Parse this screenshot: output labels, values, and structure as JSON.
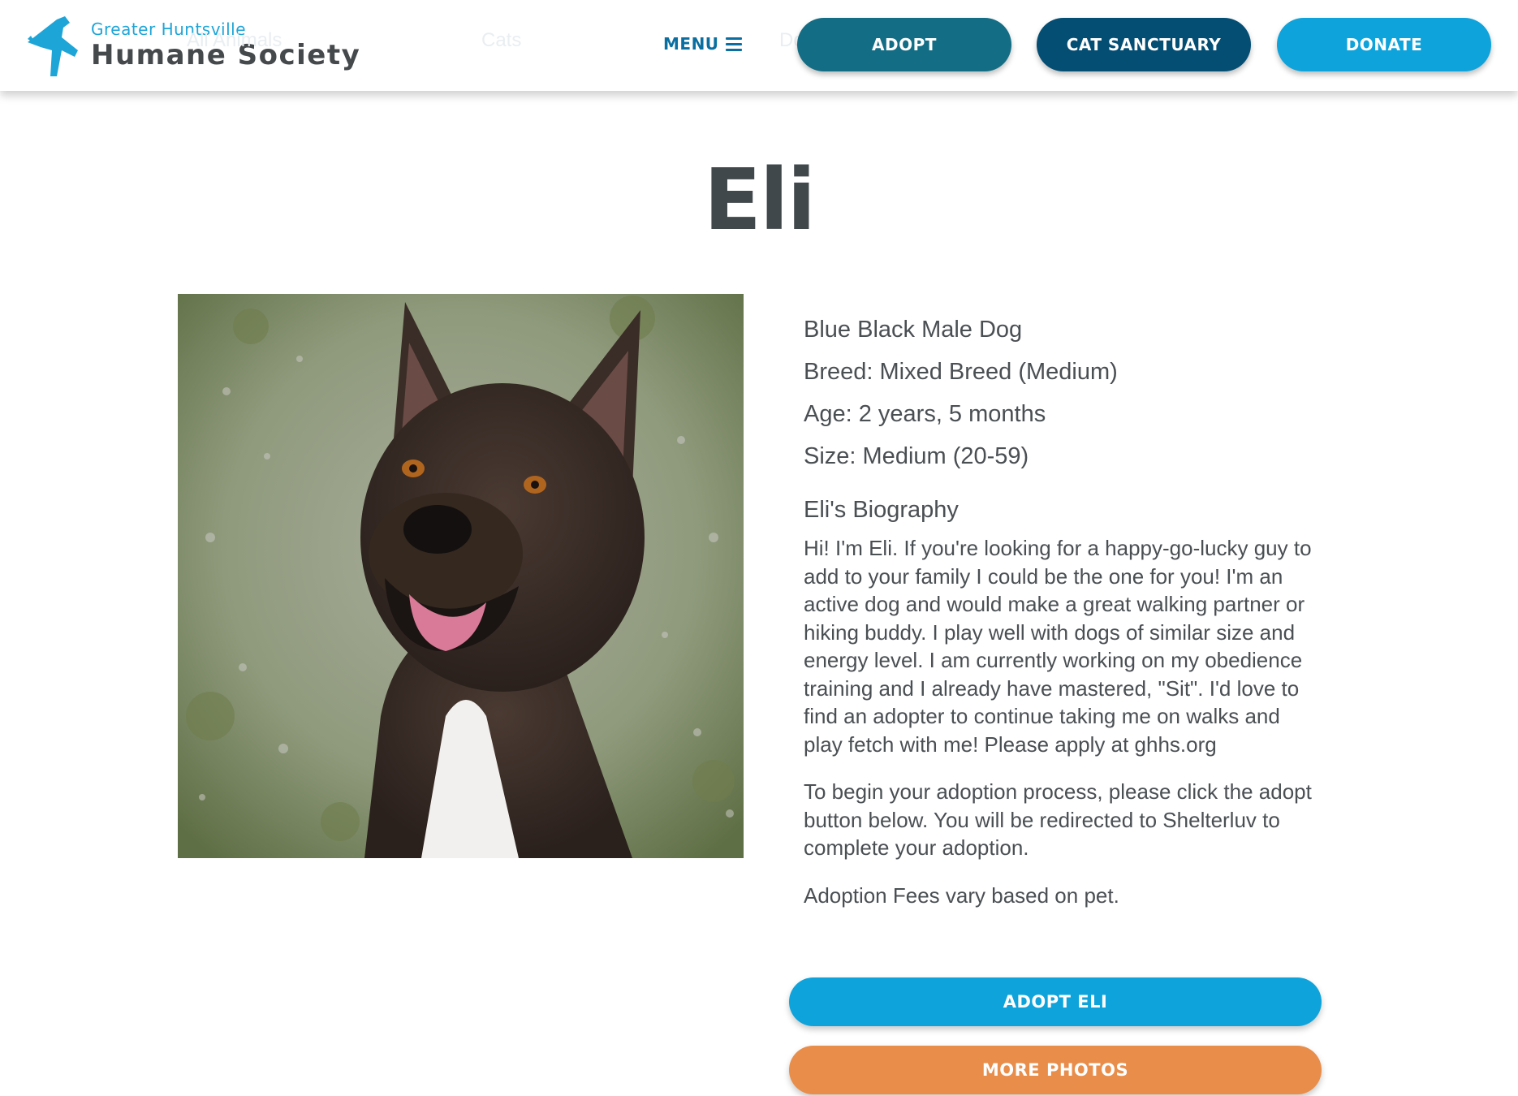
{
  "header": {
    "logo_small": "Greater Huntsville",
    "logo_big": "Humane Society",
    "ghost_links": [
      "All Animals",
      "Cats",
      "Dogs"
    ],
    "menu_label": "MENU",
    "adopt_label": "ADOPT",
    "sanctuary_label": "CAT SANCTUARY",
    "donate_label": "DONATE"
  },
  "pet": {
    "name": "Eli",
    "description": "Blue Black Male Dog",
    "breed": "Breed: Mixed Breed (Medium)",
    "age": "Age: 2 years, 5 months",
    "size": "Size: Medium (20-59)",
    "bio_heading": "Eli's Biography",
    "bio": "Hi! I'm Eli. If you're looking for a happy-go-lucky guy to add to your family I could be the one for you! I'm an active dog and would make a great walking partner or hiking buddy. I play well with dogs of similar size and energy level. I am currently working on my obedience training and I already have mastered, \"Sit\". I'd love to find an adopter to continue taking me on walks and play fetch with me! Please apply at ghhs.org",
    "adoption_process": "To begin your adoption process, please click the adopt button below. You will be redirected to Shelterluv to complete your adoption.",
    "fees": "Adoption Fees vary based on pet."
  },
  "actions": {
    "adopt_label": "ADOPT ELI",
    "photos_label": "MORE PHOTOS"
  },
  "colors": {
    "brand_blue": "#0ea3db",
    "dark_teal": "#136d84",
    "navy": "#044e74",
    "orange": "#e88d4a",
    "text": "#4a4f53"
  }
}
